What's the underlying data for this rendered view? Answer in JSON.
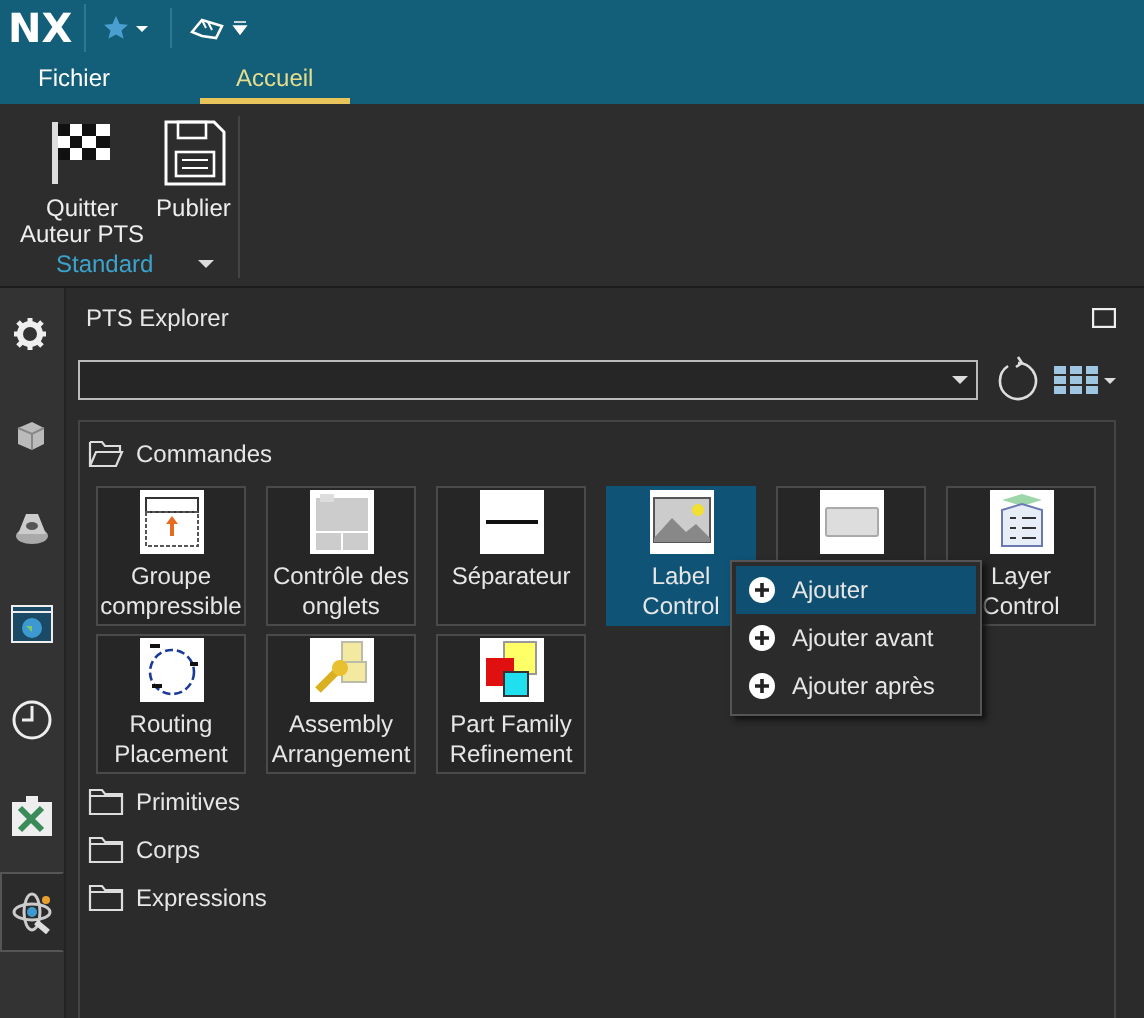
{
  "app": {
    "logo": "NX"
  },
  "tabs": [
    {
      "label": "Fichier",
      "selected": false
    },
    {
      "label": "Accueil",
      "selected": true
    }
  ],
  "ribbon": {
    "buttons": [
      {
        "label": "Quitter\nAuteur PTS"
      },
      {
        "label": "Publier"
      }
    ],
    "group": "Standard"
  },
  "sidebar": {
    "items": [
      {
        "selected": false
      },
      {
        "selected": false
      },
      {
        "selected": false
      },
      {
        "selected": false
      },
      {
        "selected": false
      },
      {
        "selected": false
      },
      {
        "selected": true
      }
    ]
  },
  "panel": {
    "title": "PTS Explorer",
    "sections": [
      {
        "label": "Commandes",
        "expanded": true,
        "tiles": [
          {
            "label": "Groupe\ncompressible",
            "selected": false
          },
          {
            "label": "Contrôle des\nonglets",
            "selected": false
          },
          {
            "label": "Séparateur",
            "selected": false
          },
          {
            "label": "Label\nControl",
            "selected": true
          },
          {
            "selected": false
          },
          {
            "label": "Layer\nControl",
            "selected": false
          },
          {
            "label": "Routing\nPlacement",
            "selected": false
          },
          {
            "label": "Assembly\nArrangement",
            "selected": false
          },
          {
            "label": "Part Family\nRefinement",
            "selected": false
          }
        ]
      },
      {
        "label": "Primitives",
        "expanded": false
      },
      {
        "label": "Corps",
        "expanded": false
      },
      {
        "label": "Expressions",
        "expanded": false
      }
    ]
  },
  "context_menu": {
    "items": [
      {
        "label": "Ajouter",
        "selected": true
      },
      {
        "label": "Ajouter avant",
        "selected": false
      },
      {
        "label": "Ajouter après",
        "selected": false
      }
    ]
  }
}
